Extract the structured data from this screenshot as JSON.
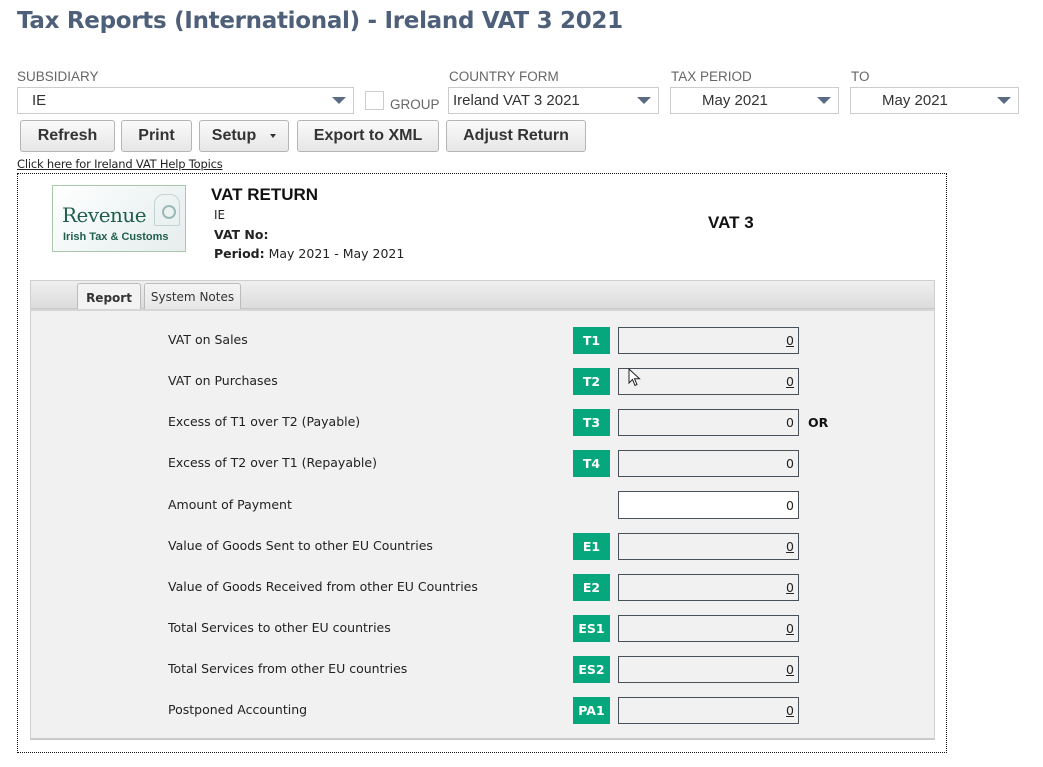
{
  "page": {
    "title": "Tax Reports (International) - Ireland VAT 3 2021"
  },
  "filters": {
    "subsidiary": {
      "label": "SUBSIDIARY",
      "value": "IE",
      "icon": "chevron-down-icon"
    },
    "group": {
      "label": "GROUP",
      "checked": false
    },
    "country_form": {
      "label": "COUNTRY FORM",
      "value": "Ireland VAT 3 2021",
      "icon": "chevron-down-icon"
    },
    "tax_period": {
      "label": "TAX PERIOD",
      "value": "May 2021",
      "icon": "chevron-down-icon"
    },
    "to": {
      "label": "TO",
      "value": "May 2021",
      "icon": "chevron-down-icon"
    }
  },
  "toolbar": {
    "refresh": "Refresh",
    "print": "Print",
    "setup": "Setup",
    "export_xml": "Export to XML",
    "adjust_return": "Adjust Return"
  },
  "help_link": "Click here for Ireland VAT Help Topics",
  "report": {
    "logo": {
      "name": "Revenue",
      "tagline": "Irish Tax & Customs"
    },
    "heading": "VAT RETURN",
    "subsidiary": "IE",
    "vat_no_label": "VAT No:",
    "vat_no_value": "",
    "period_label": "Period:",
    "period_value": "May 2021 - May 2021",
    "form_name": "VAT 3",
    "or_label": "OR",
    "tabs": [
      {
        "label": "Report",
        "active": true
      },
      {
        "label": "System Notes",
        "active": false
      }
    ],
    "rows": [
      {
        "label": "VAT on Sales",
        "code": "T1",
        "value": "0",
        "drilldown": true
      },
      {
        "label": "VAT on Purchases",
        "code": "T2",
        "value": "0",
        "drilldown": true
      },
      {
        "label": "Excess of T1 over T2 (Payable)",
        "code": "T3",
        "value": "0",
        "drilldown": false
      },
      {
        "label": "Excess of T2 over T1 (Repayable)",
        "code": "T4",
        "value": "0",
        "drilldown": false
      },
      {
        "label": "Amount of Payment",
        "code": "",
        "value": "0",
        "drilldown": false,
        "editable": true
      },
      {
        "label": "Value of Goods Sent to other EU Countries",
        "code": "E1",
        "value": "0",
        "drilldown": true
      },
      {
        "label": "Value of Goods Received from other EU Countries",
        "code": "E2",
        "value": "0",
        "drilldown": true
      },
      {
        "label": "Total Services to other EU countries",
        "code": "ES1",
        "value": "0",
        "drilldown": true
      },
      {
        "label": "Total Services from other EU countries",
        "code": "ES2",
        "value": "0",
        "drilldown": true
      },
      {
        "label": "Postponed Accounting",
        "code": "PA1",
        "value": "0",
        "drilldown": true
      }
    ]
  },
  "colors": {
    "title": "#4d5f79",
    "code_badge": "#06a77d",
    "panel_bg": "#f1f1f1"
  }
}
